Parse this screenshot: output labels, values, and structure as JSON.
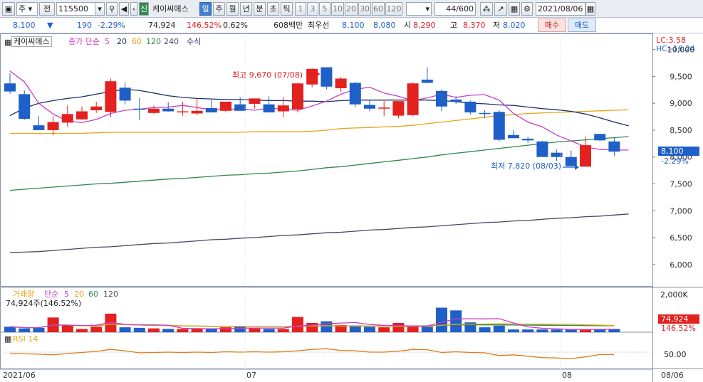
{
  "toolbar": {
    "market": "주",
    "jeon": "전",
    "code": "115500",
    "new_badge": "신",
    "stock_name": "케이씨에스",
    "periods": [
      "일",
      "주",
      "월",
      "년",
      "분",
      "초",
      "틱"
    ],
    "active_period": "일",
    "counts": [
      "1",
      "3",
      "5",
      "10",
      "20",
      "30",
      "60",
      "120"
    ],
    "bar_count": "44",
    "bar_max": "/600",
    "date": "2021/08/06"
  },
  "quote": {
    "price": "8,100",
    "change": "190",
    "change_pct": "-2.29%",
    "volume": "74,924",
    "volume_ratio": "146.52%",
    "turnover_pct": "0.62%",
    "amount": "608백만",
    "best_label": "최우선",
    "ask": "8,100",
    "bid": "8,080",
    "open_label": "시",
    "open": "8,290",
    "high_label": "고",
    "high": "8,370",
    "low_label": "저",
    "low": "8,020",
    "buy_label": "매수",
    "sell_label": "매도"
  },
  "legend": {
    "name": "케이씨에스",
    "text": "종가 단순",
    "ma": [
      "5",
      "20",
      "60",
      "120",
      "240"
    ],
    "formula": "수식"
  },
  "indicators": {
    "lc": "LC:3.58",
    "hc": "HC:-16.24"
  },
  "annotations": {
    "high": "최고 9,670 (07/08)",
    "low": "최저 7,820 (08/03)"
  },
  "price_axis": [
    "10,000",
    "9,500",
    "9,000",
    "8,500",
    "8,000",
    "7,500",
    "7,000",
    "6,500",
    "6,000"
  ],
  "last_price": "8,100",
  "last_pct": "-2.29%",
  "volume_panel": {
    "title": "거래량",
    "ma_label": "단순",
    "ma": [
      "5",
      "20",
      "60",
      "120"
    ],
    "info": "74,924주(146.52%)",
    "axis": "2,000K",
    "value": "74,924",
    "pct": "146.52%"
  },
  "rsi_panel": {
    "title": "RSI 14",
    "axis": "50.00"
  },
  "date_axis": [
    "2021/06",
    "07",
    "08",
    "08/06"
  ],
  "colors": {
    "up": "#e3211f",
    "down": "#1f5fc8",
    "ma5": "#c83cc8",
    "ma20": "#1c2f6b",
    "ma60": "#e8a317",
    "ma120": "#2c8a4a",
    "ma240": "#424a5c"
  },
  "chart_data": {
    "type": "candlestick",
    "dates": [
      "2021/06",
      "",
      "",
      "",
      "",
      "",
      "",
      "",
      "",
      "",
      "",
      "",
      "",
      "",
      "",
      "",
      "",
      "07",
      "",
      "",
      "",
      "",
      "",
      "",
      "",
      "",
      "",
      "",
      "",
      "",
      "",
      "",
      "",
      "",
      "",
      "",
      "",
      "",
      "08",
      "",
      "",
      "",
      "",
      "08/06"
    ],
    "candles": [
      {
        "o": 9370,
        "h": 9560,
        "l": 9180,
        "c": 9220
      },
      {
        "o": 9170,
        "h": 9240,
        "l": 8690,
        "c": 8710
      },
      {
        "o": 8590,
        "h": 8760,
        "l": 8520,
        "c": 8500
      },
      {
        "o": 8500,
        "h": 8760,
        "l": 8400,
        "c": 8650
      },
      {
        "o": 8640,
        "h": 8960,
        "l": 8560,
        "c": 8800
      },
      {
        "o": 8700,
        "h": 8940,
        "l": 8690,
        "c": 8850
      },
      {
        "o": 8870,
        "h": 9030,
        "l": 8820,
        "c": 8940
      },
      {
        "o": 8840,
        "h": 9460,
        "l": 8740,
        "c": 9410
      },
      {
        "o": 9290,
        "h": 9390,
        "l": 8980,
        "c": 9050
      },
      {
        "o": 8900,
        "h": 9100,
        "l": 8690,
        "c": 8890
      },
      {
        "o": 8820,
        "h": 8960,
        "l": 8800,
        "c": 8900
      },
      {
        "o": 8900,
        "h": 9020,
        "l": 8840,
        "c": 8850
      },
      {
        "o": 8850,
        "h": 9030,
        "l": 8770,
        "c": 8850
      },
      {
        "o": 8810,
        "h": 9100,
        "l": 8780,
        "c": 8860
      },
      {
        "o": 8910,
        "h": 9060,
        "l": 8850,
        "c": 8830
      },
      {
        "o": 8860,
        "h": 8990,
        "l": 8830,
        "c": 9030
      },
      {
        "o": 8980,
        "h": 9110,
        "l": 8900,
        "c": 8860
      },
      {
        "o": 8990,
        "h": 9070,
        "l": 8900,
        "c": 9090
      },
      {
        "o": 8980,
        "h": 9130,
        "l": 8830,
        "c": 8830
      },
      {
        "o": 8850,
        "h": 9110,
        "l": 8740,
        "c": 8960
      },
      {
        "o": 8890,
        "h": 9380,
        "l": 8830,
        "c": 9370
      },
      {
        "o": 9350,
        "h": 9650,
        "l": 9300,
        "c": 9640
      },
      {
        "o": 9670,
        "h": 9670,
        "l": 9260,
        "c": 9310
      },
      {
        "o": 9280,
        "h": 9490,
        "l": 9210,
        "c": 9460
      },
      {
        "o": 9380,
        "h": 9400,
        "l": 8930,
        "c": 8980
      },
      {
        "o": 8970,
        "h": 9070,
        "l": 8850,
        "c": 8900
      },
      {
        "o": 8900,
        "h": 9040,
        "l": 8760,
        "c": 8920
      },
      {
        "o": 8770,
        "h": 9010,
        "l": 8720,
        "c": 9040
      },
      {
        "o": 8780,
        "h": 9390,
        "l": 8760,
        "c": 9370
      },
      {
        "o": 9440,
        "h": 9670,
        "l": 9370,
        "c": 9380
      },
      {
        "o": 9230,
        "h": 9260,
        "l": 8850,
        "c": 8940
      },
      {
        "o": 9070,
        "h": 9130,
        "l": 8990,
        "c": 9030
      },
      {
        "o": 9030,
        "h": 9050,
        "l": 8790,
        "c": 8830
      },
      {
        "o": 8820,
        "h": 8870,
        "l": 8720,
        "c": 8800
      },
      {
        "o": 8840,
        "h": 8870,
        "l": 8290,
        "c": 8320
      },
      {
        "o": 8410,
        "h": 8500,
        "l": 8350,
        "c": 8350
      },
      {
        "o": 8340,
        "h": 8380,
        "l": 8260,
        "c": 8310
      },
      {
        "o": 8290,
        "h": 8300,
        "l": 8020,
        "c": 8000
      },
      {
        "o": 8080,
        "h": 8140,
        "l": 7930,
        "c": 8000
      },
      {
        "o": 8000,
        "h": 8120,
        "l": 7850,
        "c": 7830
      },
      {
        "o": 7820,
        "h": 8380,
        "l": 7820,
        "c": 8220
      },
      {
        "o": 8430,
        "h": 8430,
        "l": 8290,
        "c": 8310
      },
      {
        "o": 8290,
        "h": 8370,
        "l": 8020,
        "c": 8100
      }
    ],
    "volume": [
      10,
      7,
      8,
      27,
      13,
      6,
      10,
      34,
      9,
      8,
      7,
      6,
      6,
      6,
      6,
      9,
      10,
      7,
      6,
      6,
      28,
      17,
      20,
      13,
      11,
      10,
      9,
      17,
      10,
      10,
      45,
      40,
      18,
      9,
      12,
      5,
      5,
      5,
      5,
      5,
      5,
      6,
      6,
      4
    ],
    "ma5_values": [
      9600,
      9400,
      9000,
      8800,
      8670,
      8640,
      8700,
      8810,
      8870,
      8890,
      8920,
      8930,
      8960,
      8920,
      8880,
      8880,
      8900,
      8870,
      8910,
      8890,
      8870,
      8950,
      9040,
      9170,
      9260,
      9300,
      9190,
      9130,
      9050,
      9100,
      9170,
      9110,
      9150,
      9160,
      9060,
      8810,
      8650,
      8560,
      8410,
      8300,
      8190,
      8140,
      8130,
      8130
    ],
    "ma20_values": [
      8770,
      8910,
      9000,
      9050,
      9090,
      9120,
      9170,
      9220,
      9260,
      9240,
      9190,
      9140,
      9110,
      9090,
      9080,
      9070,
      9070,
      9060,
      9050,
      9050,
      9040,
      9040,
      9030,
      9050,
      9060,
      9060,
      9060,
      9060,
      9060,
      9060,
      9050,
      9030,
      9000,
      8990,
      8970,
      8960,
      8930,
      8900,
      8880,
      8850,
      8800,
      8730,
      8650,
      8580
    ],
    "ma60_values": [
      8440,
      8440,
      8440,
      8440,
      8440,
      8440,
      8450,
      8460,
      8460,
      8460,
      8460,
      8460,
      8460,
      8460,
      8460,
      8460,
      8460,
      8470,
      8470,
      8470,
      8470,
      8480,
      8500,
      8530,
      8540,
      8550,
      8560,
      8570,
      8590,
      8620,
      8650,
      8680,
      8710,
      8740,
      8770,
      8790,
      8810,
      8820,
      8830,
      8840,
      8850,
      8860,
      8870,
      8880
    ],
    "ma120_values": [
      7380,
      7400,
      7420,
      7440,
      7460,
      7480,
      7500,
      7510,
      7530,
      7550,
      7570,
      7590,
      7600,
      7620,
      7640,
      7660,
      7670,
      7690,
      7700,
      7720,
      7740,
      7770,
      7800,
      7820,
      7850,
      7880,
      7910,
      7940,
      7970,
      8000,
      8040,
      8070,
      8100,
      8130,
      8160,
      8190,
      8220,
      8250,
      8280,
      8300,
      8320,
      8340,
      8360,
      8380
    ],
    "ma240_values": [
      6220,
      6230,
      6240,
      6260,
      6280,
      6300,
      6320,
      6330,
      6350,
      6370,
      6390,
      6400,
      6420,
      6440,
      6460,
      6470,
      6490,
      6500,
      6520,
      6540,
      6550,
      6570,
      6590,
      6600,
      6620,
      6640,
      6650,
      6670,
      6690,
      6700,
      6720,
      6740,
      6760,
      6780,
      6790,
      6810,
      6820,
      6840,
      6860,
      6870,
      6890,
      6900,
      6920,
      6940
    ],
    "rsi_values": [
      46,
      45,
      44,
      42,
      46,
      49,
      52,
      58,
      54,
      48,
      49,
      50,
      49,
      50,
      49,
      51,
      50,
      51,
      50,
      51,
      54,
      58,
      60,
      55,
      54,
      50,
      50,
      53,
      58,
      57,
      49,
      51,
      49,
      48,
      40,
      42,
      38,
      34,
      33,
      31,
      36,
      43,
      43,
      41
    ],
    "ylim": [
      5600,
      10300
    ],
    "volume_ylim": [
      0,
      60
    ],
    "rsi_ylim": [
      0,
      100
    ]
  }
}
